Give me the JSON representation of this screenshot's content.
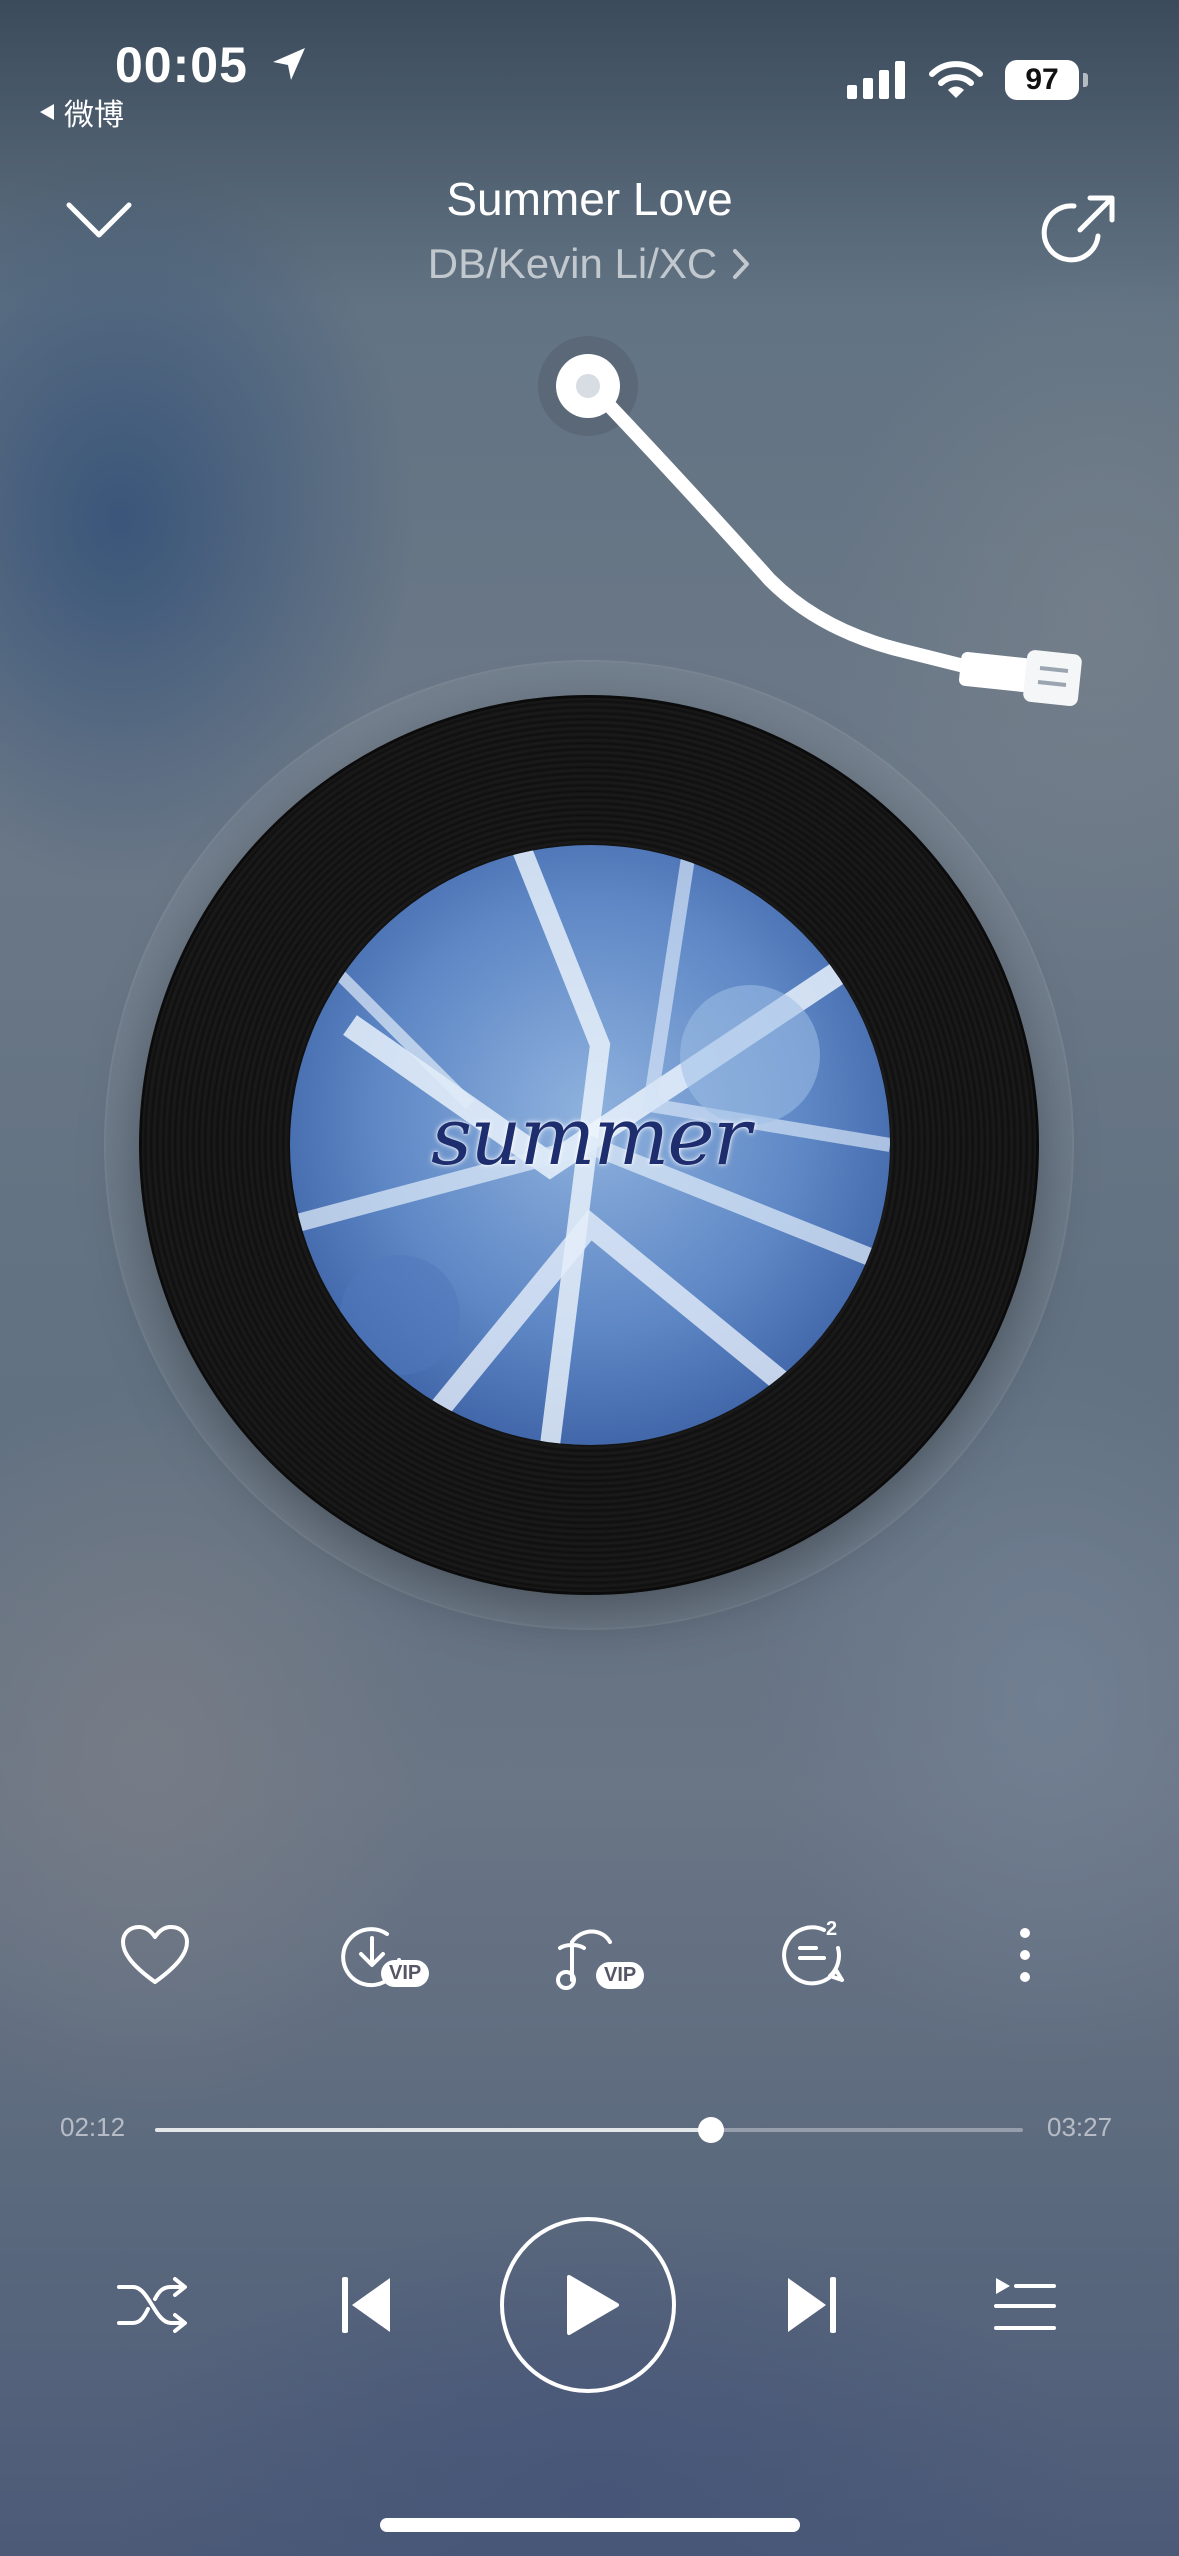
{
  "status_bar": {
    "time": "00:05",
    "back_app": "微博",
    "battery": "97"
  },
  "header": {
    "title": "Summer Love",
    "artist": "DB/Kevin Li/XC"
  },
  "record": {
    "cover_text": "summer"
  },
  "actions": [
    {
      "name": "like",
      "icon": "heart-icon"
    },
    {
      "name": "download",
      "icon": "download-icon",
      "badge": "VIP"
    },
    {
      "name": "sound-effect",
      "icon": "music-note-icon",
      "badge": "VIP"
    },
    {
      "name": "comments",
      "icon": "comment-icon",
      "count": "2"
    },
    {
      "name": "more",
      "icon": "more-vertical-icon"
    }
  ],
  "progress": {
    "current": "02:12",
    "total": "03:27",
    "fraction": 0.64
  },
  "controls": {
    "shuffle": "shuffle-icon",
    "previous": "previous-icon",
    "play": "play-icon",
    "next": "next-icon",
    "playlist": "playlist-icon"
  }
}
